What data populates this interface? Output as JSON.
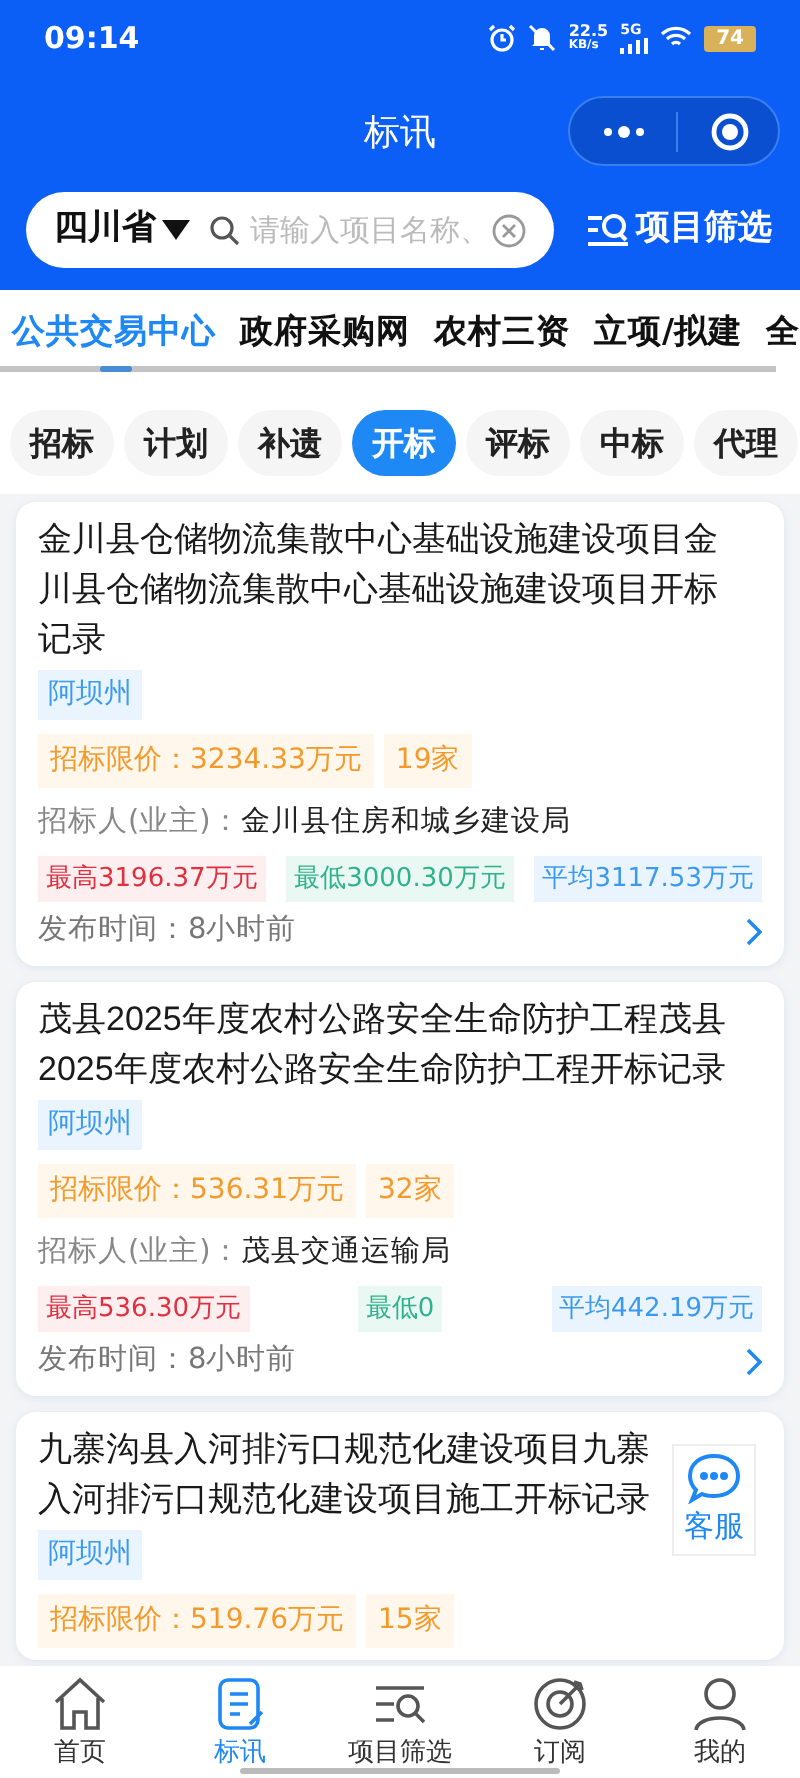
{
  "status_bar": {
    "time": "09:14",
    "net_speed": "22.5",
    "net_unit": "KB/s",
    "network": "5G",
    "battery": "74"
  },
  "header": {
    "title": "标讯"
  },
  "search": {
    "region": "四川省",
    "placeholder": "请输入项目名称、",
    "filter_label": "项目筛选"
  },
  "source_tabs": [
    {
      "label": "公共交易中心",
      "selected": true
    },
    {
      "label": "政府采购网",
      "selected": false
    },
    {
      "label": "农村三资",
      "selected": false
    },
    {
      "label": "立项/拟建",
      "selected": false
    },
    {
      "label": "全",
      "selected": false
    }
  ],
  "type_chips": [
    {
      "label": "招标",
      "selected": false
    },
    {
      "label": "计划",
      "selected": false
    },
    {
      "label": "补遗",
      "selected": false
    },
    {
      "label": "开标",
      "selected": true
    },
    {
      "label": "评标",
      "selected": false
    },
    {
      "label": "中标",
      "selected": false
    },
    {
      "label": "代理",
      "selected": false
    }
  ],
  "cards": [
    {
      "title": "金川县仓储物流集散中心基础设施建设项目金川县仓储物流集散中心基础设施建设项目开标记录",
      "region": "阿坝州",
      "price": "招标限价：3234.33万元",
      "bidders": "19家",
      "owner_label": "招标人(业主)：",
      "owner": "金川县住房和城乡建设局",
      "max": "最高3196.37万元",
      "min": "最低3000.30万元",
      "avg": "平均3117.53万元",
      "time": "发布时间：8小时前"
    },
    {
      "title": "茂县2025年度农村公路安全生命防护工程茂县2025年度农村公路安全生命防护工程开标记录",
      "region": "阿坝州",
      "price": "招标限价：536.31万元",
      "bidders": "32家",
      "owner_label": "招标人(业主)：",
      "owner": "茂县交通运输局",
      "max": "最高536.30万元",
      "min": "最低0",
      "avg": "平均442.19万元",
      "time": "发布时间：8小时前"
    },
    {
      "title_lines": [
        "九寨沟县入河排污口规范化建设项目九寨",
        "入河排污口规范化建设项目施工开标记录"
      ],
      "region": "阿坝州",
      "price": "招标限价：519.76万元",
      "bidders": "15家"
    }
  ],
  "service_button": {
    "label": "客服"
  },
  "bottom_nav": [
    {
      "label": "首页",
      "selected": false
    },
    {
      "label": "标讯",
      "selected": true
    },
    {
      "label": "项目筛选",
      "selected": false
    },
    {
      "label": "订阅",
      "selected": false
    },
    {
      "label": "我的",
      "selected": false
    }
  ]
}
